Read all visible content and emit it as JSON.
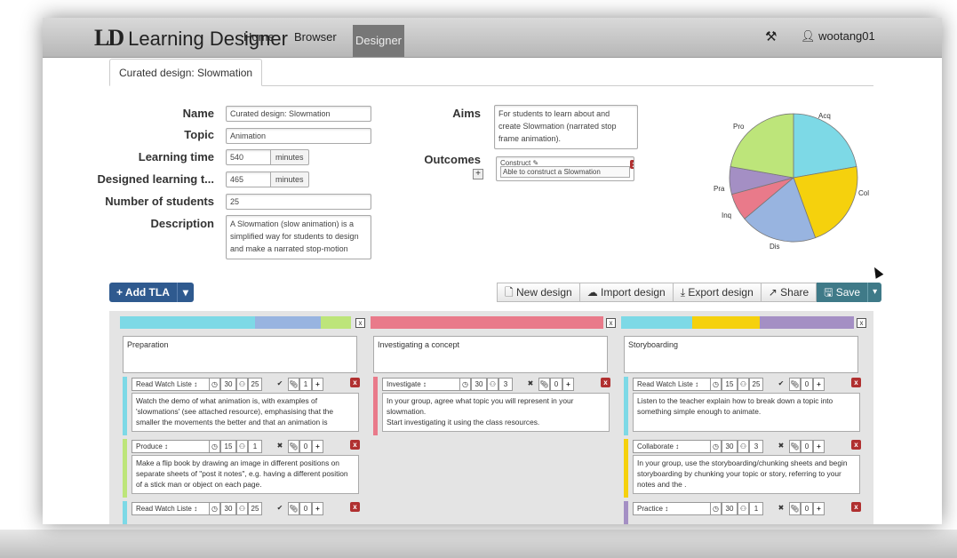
{
  "nav": {
    "logo_mark": "LD",
    "logo_text": "Learning Designer",
    "links": [
      "Home",
      "Browser"
    ],
    "active": "Designer",
    "user": "wootang01"
  },
  "tab": {
    "label": "Curated design: Slowmation"
  },
  "form": {
    "name_label": "Name",
    "name_value": "Curated design: Slowmation",
    "topic_label": "Topic",
    "topic_value": "Animation",
    "ltime_label": "Learning time",
    "ltime_value": "540",
    "ltime_unit": "minutes",
    "dtime_label": "Designed learning t...",
    "dtime_value": "465",
    "dtime_unit": "minutes",
    "students_label": "Number of students",
    "students_value": "25",
    "desc_label": "Description",
    "desc_value": "A Slowmation (slow animation) is a simplified way for students to design and make a narrated stop-motion",
    "aims_label": "Aims",
    "aims_value": "For students to learn about and create Slowmation (narrated stop frame animation).",
    "outcomes_label": "Outcomes",
    "outcome_tag": "Construct",
    "outcome_value": "Able to construct a Slowmation"
  },
  "pie": {
    "labels": {
      "acq": "Acq",
      "col": "Col",
      "dis": "Dis",
      "inq": "Inq",
      "pra": "Pra",
      "pro": "Pro"
    },
    "colors": {
      "acq": "#7dd9e6",
      "col": "#f5d10d",
      "dis": "#98b4e0",
      "inq": "#e97a8a",
      "pra": "#a48fc4",
      "pro": "#bde57a"
    }
  },
  "toolbar": {
    "add_tla": "+ Add TLA",
    "new_design": "New design",
    "import_design": "Import design",
    "export_design": "Export design",
    "share": "Share",
    "save": "Save"
  },
  "columns": [
    {
      "title": "Preparation",
      "tlas": [
        {
          "type": "Read Watch Liste",
          "time": "30",
          "students": "25",
          "count": "1",
          "text": "Watch the demo of what animation is, with examples of 'slowmations' (see attached resource), emphasising that the smaller the movements the better and that an animation is"
        },
        {
          "type": "Produce",
          "time": "15",
          "students": "1",
          "count": "0",
          "text": "Make a flip book by drawing an image in different positions on separate sheets of \"post it notes\", e.g. having a different position of a stick man or object on each page."
        },
        {
          "type": "Read Watch Liste",
          "time": "30",
          "students": "25",
          "count": "0",
          "text": ""
        }
      ]
    },
    {
      "title": "Investigating a concept",
      "tlas": [
        {
          "type": "Investigate",
          "time": "30",
          "students": "3",
          "count": "0",
          "text": "In your group, agree what topic you will represent in your slowmation.\nStart investigating it using the class resources."
        }
      ]
    },
    {
      "title": "Storyboarding",
      "tlas": [
        {
          "type": "Read Watch Liste",
          "time": "15",
          "students": "25",
          "count": "0",
          "text": "Listen to the teacher explain how to break down a topic into something simple enough to animate."
        },
        {
          "type": "Collaborate",
          "time": "30",
          "students": "3",
          "count": "0",
          "text": "In your group, use the storyboarding/chunking sheets and begin storyboarding by chunking your topic or story, referring to your notes and the ."
        },
        {
          "type": "Practice",
          "time": "30",
          "students": "1",
          "count": "0",
          "text": ""
        }
      ]
    }
  ]
}
